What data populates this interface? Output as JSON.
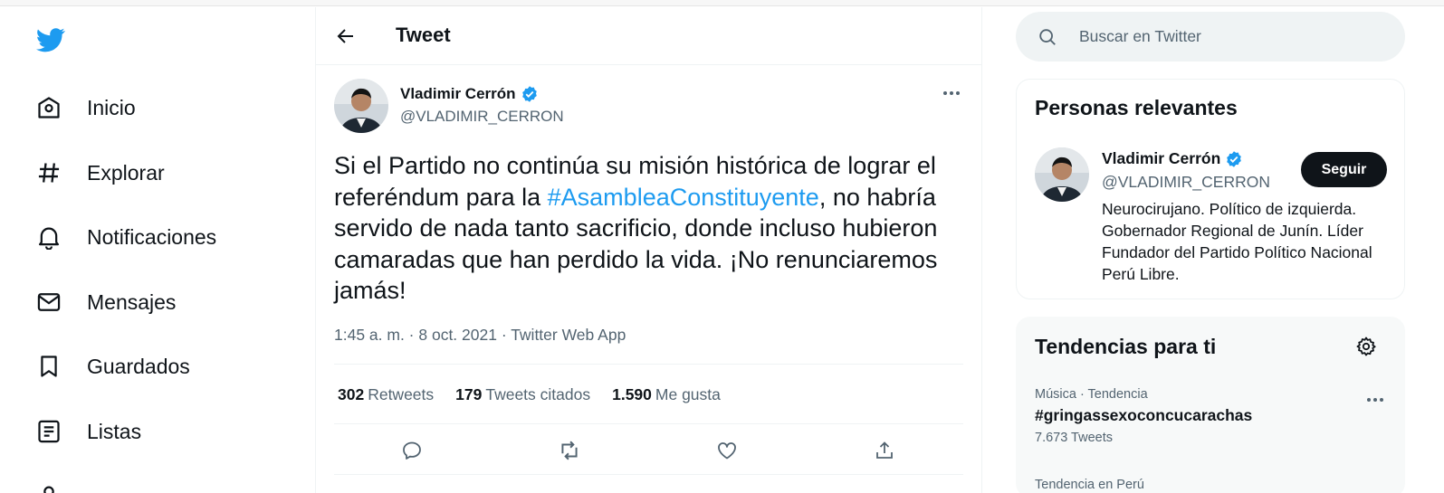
{
  "nav": {
    "items": [
      {
        "label": "Inicio",
        "icon": "home-icon"
      },
      {
        "label": "Explorar",
        "icon": "hashtag-icon"
      },
      {
        "label": "Notificaciones",
        "icon": "bell-icon"
      },
      {
        "label": "Mensajes",
        "icon": "envelope-icon"
      },
      {
        "label": "Guardados",
        "icon": "bookmark-icon"
      },
      {
        "label": "Listas",
        "icon": "list-icon"
      }
    ]
  },
  "header": {
    "title": "Tweet"
  },
  "tweet": {
    "author_name": "Vladimir Cerrón",
    "author_handle": "@VLADIMIR_CERRON",
    "text_before": "Si el Partido no continúa su misión histórica de lograr el referéndum para la ",
    "hashtag": "#AsambleaConstituyente",
    "text_after": ", no habría servido de nada tanto sacrificio, donde incluso hubieron camaradas que han perdido la vida. ¡No renunciaremos jamás!",
    "meta": "1:45 a. m. · 8 oct. 2021 · Twitter Web App",
    "stats": {
      "retweets_count": "302",
      "retweets_label": "Retweets",
      "quotes_count": "179",
      "quotes_label": "Tweets citados",
      "likes_count": "1.590",
      "likes_label": "Me gusta"
    }
  },
  "search": {
    "placeholder": "Buscar en Twitter"
  },
  "relevant": {
    "title": "Personas relevantes",
    "name": "Vladimir Cerrón",
    "handle": "@VLADIMIR_CERRON",
    "follow_label": "Seguir",
    "bio": "Neurocirujano. Político de izquierda. Gobernador Regional de Junín. Líder Fundador del Partido Político Nacional Perú Libre."
  },
  "trends": {
    "title": "Tendencias para ti",
    "items": [
      {
        "context": "Música · Tendencia",
        "title": "#gringassexoconcucarachas",
        "count": "7.673 Tweets"
      },
      {
        "context": "Tendencia en Perú"
      }
    ]
  },
  "colors": {
    "accent": "#1d9bf0",
    "text": "#0f1419",
    "muted": "#536471"
  }
}
